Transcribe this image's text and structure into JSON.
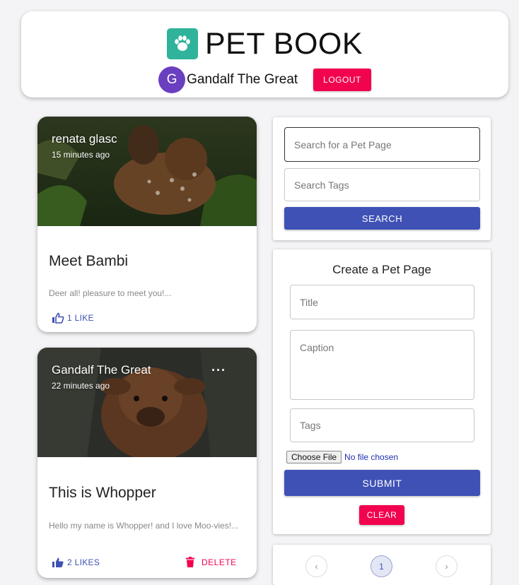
{
  "header": {
    "brand": "PET BOOK",
    "logo_icon": "paw-icon",
    "user_initial": "G",
    "user_name": "Gandalf The Great",
    "logout_label": "LOGOUT"
  },
  "posts": [
    {
      "author": "renata glasc",
      "time": "15 minutes ago",
      "title": "Meet Bambi",
      "text": "Deer all! pleasure to meet you!...",
      "likes_label": "1 LIKE",
      "image": "fawn-photo"
    },
    {
      "author": "Gandalf The Great",
      "time": "22 minutes ago",
      "more_label": "···",
      "title": "This is Whopper",
      "text": "Hello my name is Whopper! and I love Moo-vies!...",
      "likes_label": "2 LIKES",
      "delete_label": "DELETE",
      "image": "calf-photo"
    }
  ],
  "search": {
    "pet_page_placeholder": "Search for a Pet Page",
    "tags_placeholder": "Search Tags",
    "button_label": "SEARCH"
  },
  "create": {
    "heading": "Create a Pet Page",
    "title_placeholder": "Title",
    "caption_placeholder": "Caption",
    "tags_placeholder": "Tags",
    "file_button": "Choose File",
    "file_status": "No file chosen",
    "submit_label": "SUBMIT",
    "clear_label": "CLEAR"
  },
  "pagination": {
    "prev": "‹",
    "current_page": "1",
    "next": "›"
  },
  "colors": {
    "primary": "#3f51b5",
    "accent": "#f2034e",
    "logo": "#2fb39a",
    "avatar": "#6a3fc0"
  }
}
